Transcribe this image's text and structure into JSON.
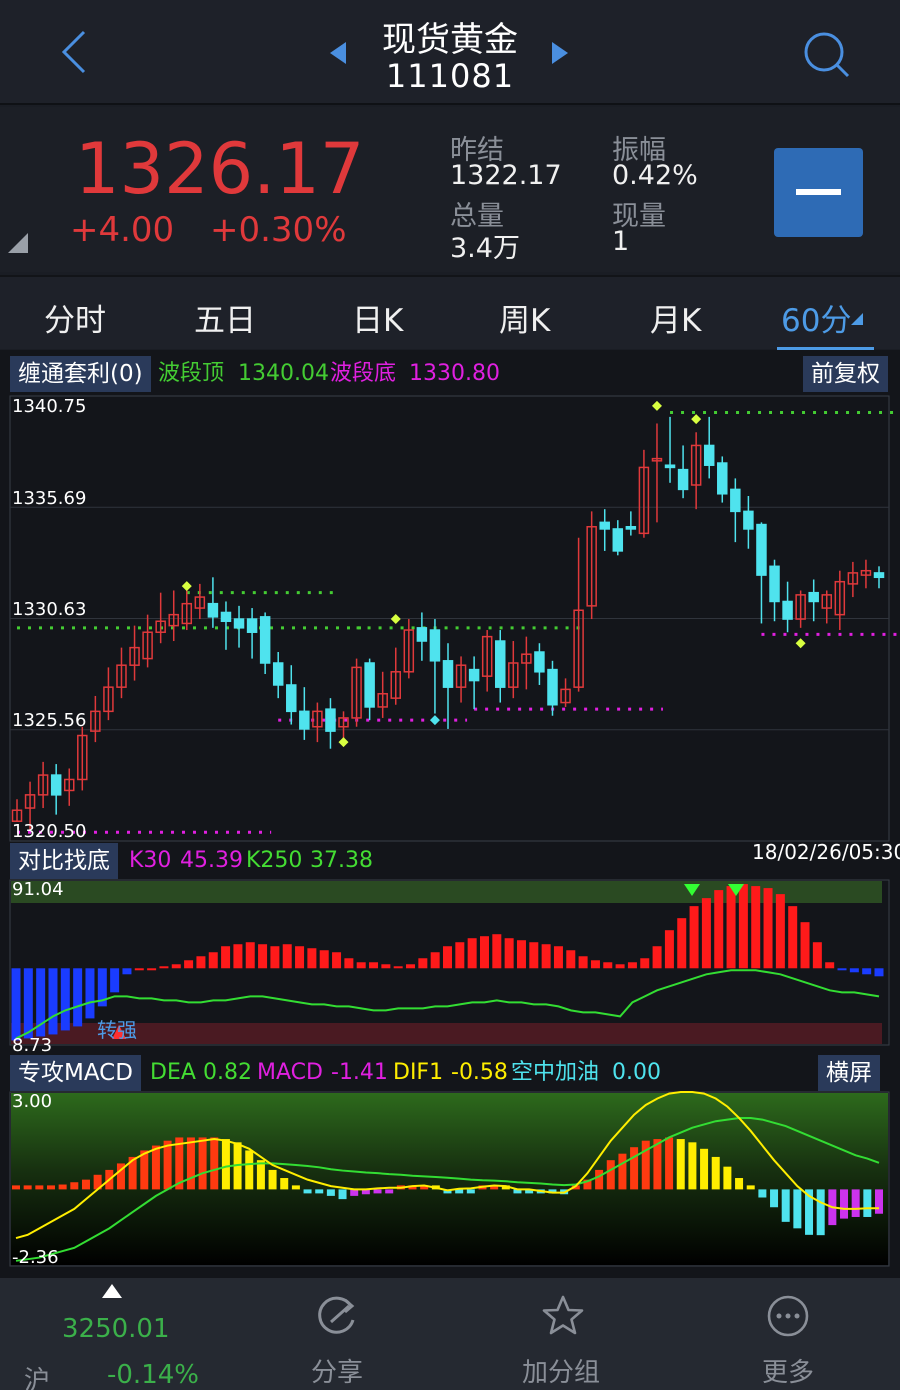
{
  "header": {
    "title": "现货黄金",
    "code": "111081"
  },
  "quote": {
    "price": "1326.17",
    "change": "+4.00",
    "change_pct": "+0.30%",
    "prev_close_label": "昨结",
    "prev_close": "1322.17",
    "amplitude_label": "振幅",
    "amplitude": "0.42%",
    "volume_label": "总量",
    "volume": "3.4万",
    "current_vol_label": "现量",
    "current_vol": "1"
  },
  "tabs": [
    "分时",
    "五日",
    "日K",
    "周K",
    "月K",
    "60分"
  ],
  "active_tab": "60分",
  "main_indicator": {
    "tag": "缠通套利(0)",
    "top_label": "波段顶",
    "top_value": "1340.04",
    "bottom_label": "波段底",
    "bottom_value": "1330.80",
    "adjust_button": "前复权",
    "timestamp": "18/02/26/05:30"
  },
  "sub_indicator1": {
    "tag": "对比找底",
    "k30_label": "K30",
    "k30_value": "45.39",
    "k250_label": "K250",
    "k250_value": "37.38",
    "annotation": "转强"
  },
  "sub_indicator2": {
    "tag": "专攻MACD",
    "dea_label": "DEA",
    "dea_value": "0.82",
    "macd_label": "MACD",
    "macd_value": "-1.41",
    "dif_label": "DIF1",
    "dif_value": "-0.58",
    "extra_label": "空中加油",
    "extra_value": "0.00",
    "landscape_button": "横屏"
  },
  "footer": {
    "index_value": "3250.01",
    "index_name": "沪",
    "index_change": "-0.14%",
    "share_label": "分享",
    "add_group_label": "加分组",
    "more_label": "更多"
  },
  "colors": {
    "up": "#e0393b",
    "down": "#4fe3ee",
    "accent": "#4d9be6",
    "top_line": "#44cc33",
    "bottom_line": "#e020e0"
  },
  "chart_data": [
    {
      "type": "candlestick",
      "ylim": [
        1320.5,
        1340.75
      ],
      "y_ticks": [
        "1340.75",
        "1335.69",
        "1330.63",
        "1325.56",
        "1320.50"
      ],
      "candles": [
        [
          1321.4,
          1321.9,
          1321.4,
          1322.4
        ],
        [
          1322.0,
          1322.6,
          1321.0,
          1323.2
        ],
        [
          1322.6,
          1323.5,
          1322.0,
          1324.1
        ],
        [
          1323.5,
          1322.6,
          1321.7,
          1324.0
        ],
        [
          1322.8,
          1323.3,
          1322.1,
          1323.8
        ],
        [
          1323.3,
          1325.3,
          1322.8,
          1325.7
        ],
        [
          1325.5,
          1326.4,
          1325.0,
          1327.1
        ],
        [
          1326.4,
          1327.5,
          1326.0,
          1328.4
        ],
        [
          1327.5,
          1328.5,
          1327.0,
          1329.3
        ],
        [
          1328.5,
          1329.3,
          1327.8,
          1330.3
        ],
        [
          1328.8,
          1330.0,
          1328.4,
          1330.8
        ],
        [
          1330.0,
          1330.5,
          1329.5,
          1331.8
        ],
        [
          1330.3,
          1330.8,
          1329.6,
          1331.9
        ],
        [
          1330.4,
          1331.3,
          1330.1,
          1332.1
        ],
        [
          1331.1,
          1331.6,
          1330.6,
          1332.2
        ],
        [
          1331.3,
          1330.7,
          1330.2,
          1332.5
        ],
        [
          1330.9,
          1330.5,
          1329.2,
          1331.4
        ],
        [
          1330.6,
          1330.2,
          1329.3,
          1331.2
        ],
        [
          1330.6,
          1330.0,
          1328.8,
          1331.1
        ],
        [
          1330.7,
          1328.6,
          1328.1,
          1330.9
        ],
        [
          1328.6,
          1327.6,
          1327.0,
          1329.1
        ],
        [
          1327.6,
          1326.4,
          1325.8,
          1328.5
        ],
        [
          1326.4,
          1325.6,
          1325.1,
          1327.5
        ],
        [
          1325.7,
          1326.4,
          1325.0,
          1326.8
        ],
        [
          1326.5,
          1325.5,
          1324.7,
          1327.0
        ],
        [
          1325.7,
          1326.1,
          1324.9,
          1326.4
        ],
        [
          1326.1,
          1328.4,
          1325.7,
          1328.8
        ],
        [
          1328.6,
          1326.6,
          1326.0,
          1328.8
        ],
        [
          1326.6,
          1327.2,
          1326.1,
          1328.2
        ],
        [
          1327.0,
          1328.2,
          1326.7,
          1329.3
        ],
        [
          1328.2,
          1330.1,
          1327.9,
          1330.6
        ],
        [
          1330.2,
          1329.6,
          1328.7,
          1330.9
        ],
        [
          1330.1,
          1328.7,
          1326.3,
          1330.6
        ],
        [
          1328.7,
          1327.5,
          1325.6,
          1329.5
        ],
        [
          1327.5,
          1328.5,
          1326.8,
          1328.9
        ],
        [
          1328.3,
          1327.8,
          1326.5,
          1328.9
        ],
        [
          1328.0,
          1329.8,
          1327.3,
          1330.1
        ],
        [
          1329.6,
          1327.5,
          1326.8,
          1330.1
        ],
        [
          1327.5,
          1328.6,
          1327.0,
          1329.6
        ],
        [
          1328.6,
          1329.0,
          1327.4,
          1329.8
        ],
        [
          1329.1,
          1328.2,
          1327.6,
          1329.5
        ],
        [
          1328.3,
          1326.7,
          1326.2,
          1328.7
        ],
        [
          1326.8,
          1327.4,
          1326.6,
          1327.9
        ],
        [
          1327.5,
          1331.0,
          1327.3,
          1334.3
        ],
        [
          1331.2,
          1334.8,
          1330.6,
          1335.5
        ],
        [
          1335.0,
          1334.7,
          1333.7,
          1335.6
        ],
        [
          1334.7,
          1333.7,
          1333.5,
          1335.1
        ],
        [
          1334.8,
          1334.7,
          1334.4,
          1335.5
        ],
        [
          1334.5,
          1337.5,
          1334.3,
          1338.3
        ],
        [
          1337.8,
          1337.9,
          1335.0,
          1339.5
        ],
        [
          1337.6,
          1337.5,
          1336.8,
          1339.8
        ],
        [
          1337.4,
          1336.5,
          1336.1,
          1338.5
        ],
        [
          1336.7,
          1338.5,
          1335.6,
          1339.1
        ],
        [
          1338.5,
          1337.6,
          1337.0,
          1339.8
        ],
        [
          1337.7,
          1336.3,
          1335.9,
          1338.0
        ],
        [
          1336.5,
          1335.5,
          1334.1,
          1337.0
        ],
        [
          1335.5,
          1334.7,
          1333.8,
          1336.2
        ],
        [
          1334.9,
          1332.6,
          1330.4,
          1335.0
        ],
        [
          1333.0,
          1331.4,
          1330.5,
          1333.3
        ],
        [
          1331.4,
          1330.6,
          1330.0,
          1332.3
        ],
        [
          1330.6,
          1331.7,
          1330.2,
          1331.9
        ],
        [
          1331.8,
          1331.4,
          1330.5,
          1332.4
        ],
        [
          1331.1,
          1331.7,
          1330.4,
          1331.9
        ],
        [
          1330.8,
          1332.3,
          1330.1,
          1332.8
        ],
        [
          1332.2,
          1332.7,
          1331.6,
          1333.2
        ],
        [
          1332.6,
          1332.8,
          1332.0,
          1333.3
        ],
        [
          1332.7,
          1332.5,
          1332.0,
          1333.0
        ]
      ],
      "band_top_segments": [
        [
          1330.2,
          0,
          26,
          "#44cc33"
        ],
        [
          1331.8,
          13,
          24,
          "#44cc33"
        ],
        [
          1330.2,
          26,
          43,
          "#44cc33"
        ],
        [
          1340.0,
          50,
          67,
          "#44cc33"
        ]
      ],
      "band_bottom_segments": [
        [
          1320.9,
          0,
          19,
          "#e020e0"
        ],
        [
          1326.0,
          20,
          34,
          "#e020e0"
        ],
        [
          1326.5,
          35,
          49,
          "#e020e0"
        ],
        [
          1329.9,
          57,
          67,
          "#e020e0"
        ]
      ]
    },
    {
      "type": "bar",
      "name": "对比找底",
      "ylim": [
        8.73,
        91.04
      ],
      "y_ticks": [
        "91.04",
        "8.73"
      ],
      "baseline": 47,
      "values": [
        11,
        12,
        13,
        14,
        16,
        18,
        22,
        28,
        35,
        44,
        47,
        47,
        48,
        49,
        51,
        53,
        55,
        58,
        59,
        60,
        59,
        58,
        59,
        58,
        57,
        56,
        55,
        52,
        50,
        50,
        49,
        48,
        49,
        52,
        55,
        58,
        60,
        62,
        63,
        64,
        62,
        61,
        60,
        59,
        58,
        56,
        53,
        51,
        50,
        49,
        50,
        52,
        58,
        66,
        72,
        78,
        82,
        86,
        88,
        89,
        88,
        87,
        84,
        78,
        70,
        60,
        50,
        46,
        45,
        44,
        43
      ],
      "k30": [
        12,
        15,
        19,
        23,
        26,
        28,
        30,
        31,
        33,
        33,
        32,
        32,
        31,
        31,
        30,
        30,
        31,
        31,
        32,
        33,
        33,
        32,
        31,
        30,
        29,
        29,
        28,
        28,
        27,
        26,
        26,
        27,
        27,
        27,
        28,
        28,
        29,
        30,
        30,
        31,
        30,
        30,
        29,
        29,
        28,
        26,
        25,
        25,
        24,
        23,
        30,
        33,
        36,
        38,
        40,
        42,
        44,
        45,
        46,
        46,
        46,
        45,
        44,
        42,
        40,
        38,
        36,
        35,
        35,
        34,
        33
      ]
    },
    {
      "type": "bar",
      "name": "专攻MACD",
      "ylim": [
        -2.36,
        3.0
      ],
      "y_ticks": [
        "3.00",
        "-2.36"
      ],
      "macd": [
        0.01,
        0.03,
        0.06,
        0.1,
        0.15,
        0.22,
        0.3,
        0.45,
        0.6,
        0.8,
        1.0,
        1.2,
        1.35,
        1.5,
        1.6,
        1.6,
        1.6,
        1.6,
        1.55,
        1.45,
        1.2,
        0.9,
        0.6,
        0.35,
        0.1,
        -0.05,
        -0.1,
        -0.2,
        -0.3,
        -0.2,
        -0.15,
        -0.1,
        -0.08,
        0.05,
        0.08,
        0.1,
        0.05,
        -0.05,
        -0.05,
        -0.05,
        0.02,
        0.05,
        0.04,
        -0.06,
        -0.06,
        -0.06,
        -0.1,
        -0.15,
        0.1,
        0.3,
        0.6,
        0.9,
        1.1,
        1.3,
        1.5,
        1.55,
        1.6,
        1.55,
        1.45,
        1.25,
        1.0,
        0.7,
        0.35,
        0.1,
        -0.25,
        -0.55,
        -1.0,
        -1.2,
        -1.4,
        -1.41,
        -1.1,
        -0.9,
        -0.85,
        -0.85,
        -0.75
      ],
      "dif": [
        -1.5,
        -1.4,
        -1.2,
        -1.0,
        -0.8,
        -0.6,
        -0.3,
        0.0,
        0.3,
        0.6,
        0.9,
        1.1,
        1.25,
        1.35,
        1.4,
        1.45,
        1.5,
        1.55,
        1.5,
        1.4,
        1.25,
        1.0,
        0.75,
        0.6,
        0.45,
        0.3,
        0.2,
        0.1,
        0.05,
        0.0,
        0.0,
        0.03,
        0.05,
        0.05,
        0.1,
        0.12,
        0.05,
        -0.03,
        0.02,
        0.03,
        0.08,
        0.12,
        0.1,
        0.0,
        0.0,
        -0.05,
        -0.1,
        -0.1,
        0.1,
        0.5,
        1.0,
        1.5,
        1.9,
        2.3,
        2.6,
        2.8,
        2.95,
        3.0,
        3.0,
        2.95,
        2.8,
        2.55,
        2.2,
        1.8,
        1.35,
        0.9,
        0.5,
        0.1,
        -0.2,
        -0.4,
        -0.55,
        -0.6,
        -0.6,
        -0.58,
        -0.58
      ],
      "dea": [
        -2.2,
        -2.15,
        -2.1,
        -2.0,
        -1.9,
        -1.8,
        -1.6,
        -1.4,
        -1.2,
        -0.95,
        -0.7,
        -0.45,
        -0.2,
        0.0,
        0.2,
        0.35,
        0.5,
        0.6,
        0.7,
        0.75,
        0.78,
        0.8,
        0.8,
        0.78,
        0.75,
        0.72,
        0.68,
        0.62,
        0.58,
        0.55,
        0.52,
        0.5,
        0.47,
        0.45,
        0.42,
        0.4,
        0.38,
        0.36,
        0.33,
        0.3,
        0.28,
        0.27,
        0.25,
        0.22,
        0.2,
        0.18,
        0.15,
        0.13,
        0.15,
        0.25,
        0.4,
        0.6,
        0.8,
        1.0,
        1.2,
        1.4,
        1.6,
        1.75,
        1.9,
        2.0,
        2.1,
        2.15,
        2.2,
        2.2,
        2.15,
        2.05,
        1.95,
        1.8,
        1.65,
        1.5,
        1.35,
        1.2,
        1.05,
        0.95,
        0.82
      ]
    }
  ]
}
